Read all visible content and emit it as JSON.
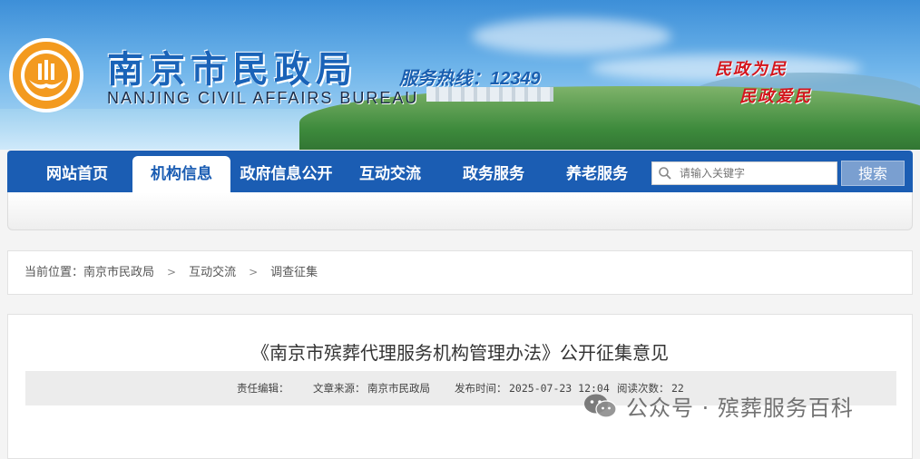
{
  "header": {
    "title_cn": "南京市民政局",
    "title_en": "NANJING CIVIL AFFAIRS BUREAU",
    "hotline": "服务热线：12349",
    "slogan_1": "民政为民",
    "slogan_2": "民政爱民",
    "logo_icon": "civil-affairs-emblem-icon"
  },
  "nav": {
    "items": [
      {
        "label": "网站首页"
      },
      {
        "label": "机构信息"
      },
      {
        "label": "政府信息公开"
      },
      {
        "label": "互动交流"
      },
      {
        "label": "政务服务"
      },
      {
        "label": "养老服务"
      }
    ],
    "active_index": 1,
    "search_placeholder": "请输入关键字",
    "search_button": "搜索",
    "accent": "#1b5db3"
  },
  "breadcrumb": {
    "prefix": "当前位置：",
    "items": [
      "南京市民政局",
      "互动交流",
      "调查征集"
    ],
    "separator": ">"
  },
  "article": {
    "title": "《南京市殡葬代理服务机构管理办法》公开征集意见",
    "meta": {
      "editor_label": "责任编辑：",
      "source_label": "文章来源：",
      "source": "南京市民政局",
      "time_label": "发布时间：",
      "time": "2025-07-23 12:04",
      "views_label": "阅读次数：",
      "views": "22"
    }
  },
  "watermark": {
    "text": "公众号 · 殡葬服务百科",
    "icon": "wechat-icon"
  }
}
